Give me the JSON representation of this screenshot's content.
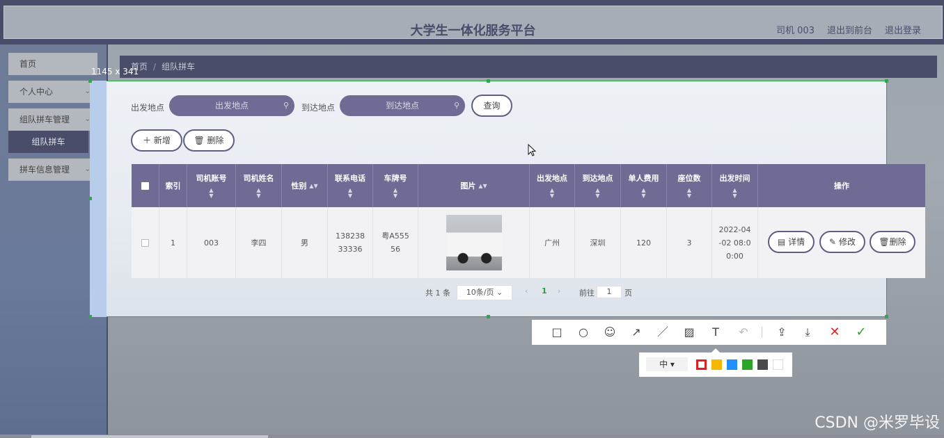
{
  "header": {
    "title": "大学生一体化服务平台",
    "links": [
      "司机 003",
      "退出到前台",
      "退出登录"
    ]
  },
  "sidebar": {
    "items": [
      "首页",
      "个人中心",
      "组队拼车管理",
      "拼车信息管理"
    ],
    "sub_active": "组队拼车"
  },
  "breadcrumb": {
    "home": "首页",
    "sep": "/",
    "current": "组队拼车"
  },
  "capture_size": "1145 x 341",
  "search": {
    "from_label": "出发地点",
    "from_placeholder": "出发地点",
    "to_label": "到达地点",
    "to_placeholder": "到达地点",
    "query_button": "查询"
  },
  "actions": {
    "add": "新增",
    "delete": "删除"
  },
  "table": {
    "headers": [
      "索引",
      "司机账号",
      "司机姓名",
      "性别",
      "联系电话",
      "车牌号",
      "图片",
      "出发地点",
      "到达地点",
      "单人费用",
      "座位数",
      "出发时间",
      "操作"
    ],
    "rows": [
      {
        "index": "1",
        "account": "003",
        "name": "李四",
        "gender": "男",
        "phone": "13823833336",
        "plate": "粤A55556",
        "from": "广州",
        "to": "深圳",
        "fee": "120",
        "seats": "3",
        "time": "2022-04-02 08:00:00"
      }
    ],
    "row_ops": [
      "详情",
      "修改",
      "删除"
    ]
  },
  "pagination": {
    "total": "共 1 条",
    "page_size": "10条/页",
    "current_page": "1",
    "goto_label": "前往",
    "goto_value": "1",
    "page_suffix": "页"
  },
  "annot_toolbar": {
    "tools": [
      "rect-icon",
      "ellipse-icon",
      "emoji-icon",
      "arrow-icon",
      "pen-icon",
      "mosaic-icon",
      "text-icon",
      "undo-icon",
      "share-icon",
      "download-icon",
      "cancel-icon",
      "confirm-icon"
    ],
    "size_label": "中",
    "colors": [
      "#e02020",
      "#f5b800",
      "#1e90ff",
      "#2aa52a",
      "#4a4a4a",
      "#ffffff"
    ]
  },
  "watermark": "CSDN @米罗毕设"
}
